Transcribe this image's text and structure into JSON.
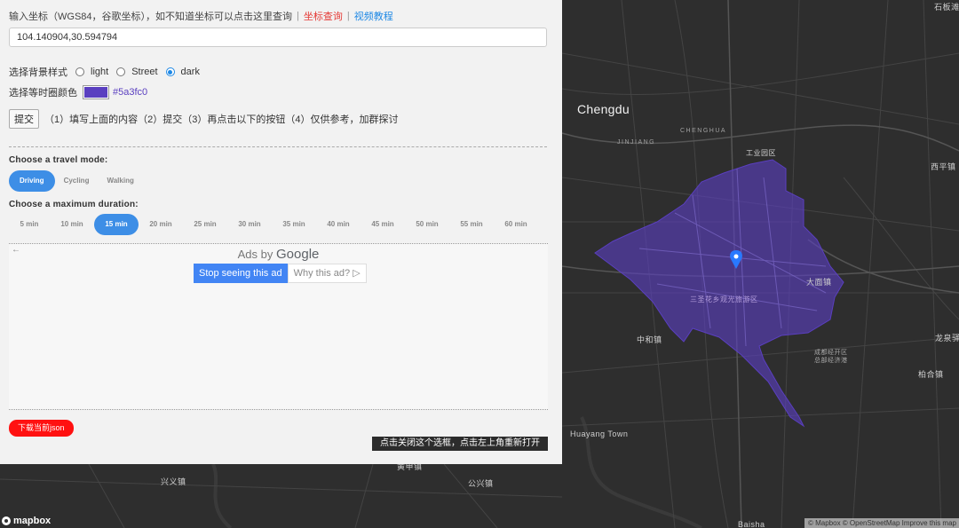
{
  "panel": {
    "coord_prompt": "输入坐标（WGS84，谷歌坐标），如不知道坐标可以点击这里查询",
    "sep": "|",
    "coord_lookup_link": "坐标查询",
    "video_tutorial_link": "视频教程",
    "coord_value": "104.140904,30.594794",
    "style_label": "选择背景样式",
    "style_options": [
      {
        "label": "light",
        "selected": false
      },
      {
        "label": "Street",
        "selected": false
      },
      {
        "label": "dark",
        "selected": true
      }
    ],
    "color_label": "选择等时圈颜色",
    "color_value": "#5a3fc0",
    "submit_label": "提交",
    "instructions": "（1）填写上面的内容（2）提交（3）再点击以下的按钮（4）仅供参考，加群探讨",
    "travel_mode_title": "Choose a travel mode:",
    "travel_modes": [
      "Driving",
      "Cycling",
      "Walking"
    ],
    "travel_mode_selected": "Driving",
    "duration_title": "Choose a maximum duration:",
    "durations": [
      "5 min",
      "10 min",
      "15 min",
      "20 min",
      "25 min",
      "30 min",
      "35 min",
      "40 min",
      "45 min",
      "50 min",
      "55 min",
      "60 min"
    ],
    "duration_selected": "15 min",
    "download_label": "下载当前json",
    "close_hint": "点击关闭这个选框，点击左上角重新打开"
  },
  "ad": {
    "back_arrow": "←",
    "ads_by": "Ads by",
    "google": "Google",
    "stop_label": "Stop seeing this ad",
    "why_label": "Why this ad? ▷"
  },
  "map": {
    "labels": {
      "chengdu": "Chengdu",
      "chenghua": "CHENGHUA",
      "jinjiang": "JINJIANG",
      "gongye": "工业园区",
      "xiping": "西平镇",
      "shibanshan": "石板滩",
      "damian": "大面镇",
      "scenic": "三圣花乡观光旅游区",
      "zhonghe": "中和镇",
      "longquan": "龙泉驿",
      "jingkai": "成都经开区\n总部经济港",
      "baihe": "柏合镇",
      "huayang": "Huayang Town",
      "xinglong": "兴义镇",
      "huangjia": "黄甲镇",
      "gongxing": "公兴镇",
      "baisha": "Baisha"
    },
    "isochrone_color": "#5a3fc0",
    "logo": "mapbox",
    "attribution": "© Mapbox © OpenStreetMap Improve this map"
  },
  "colors": {
    "accent": "#3d8ee6",
    "link_red": "#e53935",
    "link_blue": "#1e88e5",
    "download_red": "#ff1111",
    "marker": "#2979ff"
  }
}
